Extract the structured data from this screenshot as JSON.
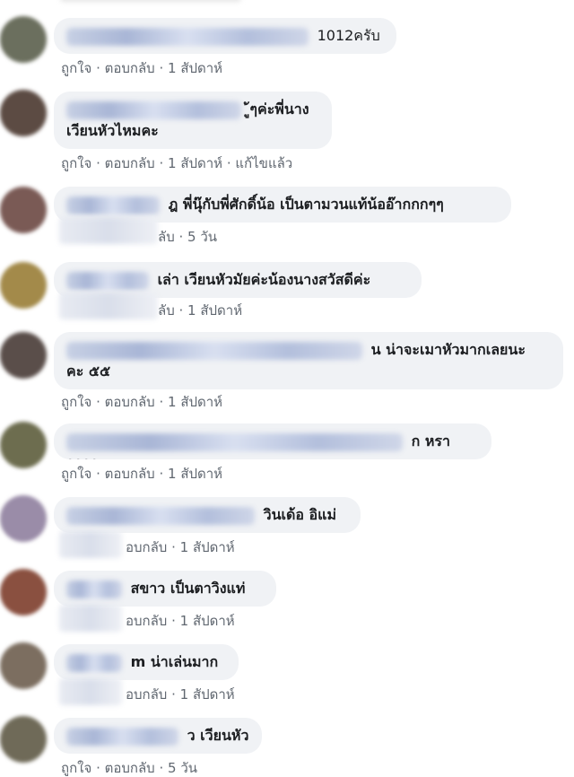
{
  "comments": [
    {
      "text": "1012ครับ",
      "like": "ถูกใจ",
      "reply": "ตอบกลับ",
      "time": "1 สัปดาห์",
      "edited": ""
    },
    {
      "text": "ู้ๆค่ะพี่นาง",
      "text2": "เวียนหัวไหมคะ",
      "like": "ถูกใจ",
      "reply": "ตอบกลับ",
      "time": "1 สัปดาห์",
      "edited": "แก้ไขแล้ว"
    },
    {
      "text": "ฎ พี่นุ๊กับพี่ศักดิ์น้อ เป็นตามวนแท้น้ออ๊ากกกๆๆ",
      "like": "",
      "reply": "ลับ",
      "time": "5 วัน",
      "edited": ""
    },
    {
      "text": "เล่า เวียนหัวมัยค่ะน้องนางสวัสดีค่ะ",
      "like": "",
      "reply": "ลับ",
      "time": "1 สัปดาห์",
      "edited": ""
    },
    {
      "text": "น น่าจะเมาหัวมากเลยนะ",
      "text2": "คะ ๕๕",
      "like": "ถูกใจ",
      "reply": "ตอบกลับ",
      "time": "1 สัปดาห์",
      "edited": ""
    },
    {
      "text": "ก หราาาาา",
      "like": "ถูกใจ",
      "reply": "ตอบกลับ",
      "time": "1 สัปดาห์",
      "edited": ""
    },
    {
      "text": "วินเด้อ อิแม่",
      "like": "",
      "reply": "อบกลับ",
      "time": "1 สัปดาห์",
      "edited": ""
    },
    {
      "text": "สขาว เป็นตาวิงแท่",
      "like": "",
      "reply": "อบกลับ",
      "time": "1 สัปดาห์",
      "edited": ""
    },
    {
      "text": "m น่าเล่นมาก",
      "like": "",
      "reply": "อบกลับ",
      "time": "1 สัปดาห์",
      "edited": ""
    },
    {
      "text": "ว เวียนหัว",
      "like": "ถูกใจ",
      "reply": "ตอบกลับ",
      "time": "5 วัน",
      "edited": ""
    }
  ],
  "separator": "·",
  "colors": {
    "bubble": "#f0f2f5",
    "meta": "#606770",
    "text": "#1c1e21"
  }
}
